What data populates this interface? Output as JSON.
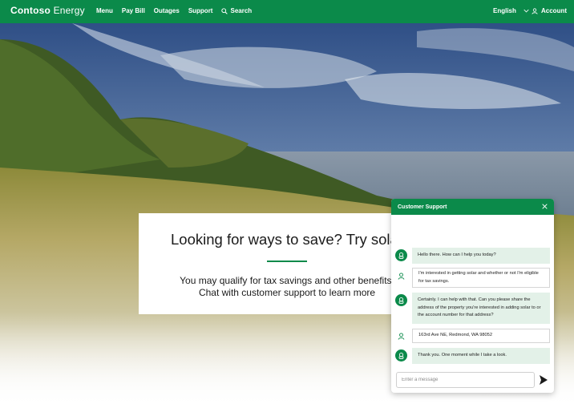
{
  "brand": {
    "bold": "Contoso",
    "rest": " Energy"
  },
  "nav": {
    "items": [
      "Menu",
      "Pay Bill",
      "Outages",
      "Support"
    ],
    "search_label": "Search",
    "language": "English",
    "account": "Account"
  },
  "colors": {
    "brand_green": "#0b8a4a",
    "bot_bubble": "#e3f1e8"
  },
  "promo": {
    "title": "Looking for ways to save? Try solar",
    "line1": "You may qualify for tax savings and other benefits.",
    "line2": "Chat with customer support to learn more"
  },
  "chat": {
    "title": "Customer Support",
    "messages": [
      {
        "from": "bot",
        "text": "Hello there. How can I help you today?"
      },
      {
        "from": "user",
        "text": "I'm interested in getting solar and whether or not I'm eligible for tax savings."
      },
      {
        "from": "bot",
        "text": "Certainly. I can help with that. Can you please share the address of the property you're interested in adding solar to or the account number for that address?"
      },
      {
        "from": "user",
        "text": "163rd Ave NE, Redmond, WA 98052"
      },
      {
        "from": "bot",
        "text": "Thank you. One moment while I take a look."
      }
    ],
    "input_placeholder": "Enter a message"
  }
}
